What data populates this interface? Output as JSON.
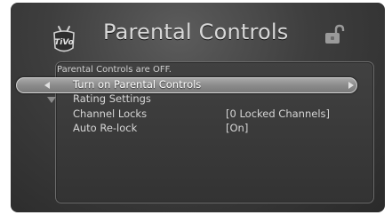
{
  "header": {
    "logo": "tivo-logo-icon",
    "title": "Parental Controls",
    "lock_icon": "padlock-open-icon"
  },
  "panel": {
    "status": "Parental Controls are OFF."
  },
  "menu": {
    "items": [
      {
        "label": "Turn on Parental Controls",
        "value": "",
        "selected": true
      },
      {
        "label": "Rating Settings",
        "value": ""
      },
      {
        "label": "Channel Locks",
        "value": "[0 Locked Channels]"
      },
      {
        "label": "Auto Re-lock",
        "value": "[On]"
      }
    ]
  },
  "colors": {
    "background": "#3a3a3a",
    "text": "#d6d6d6",
    "highlight": "#8e8e8e"
  }
}
